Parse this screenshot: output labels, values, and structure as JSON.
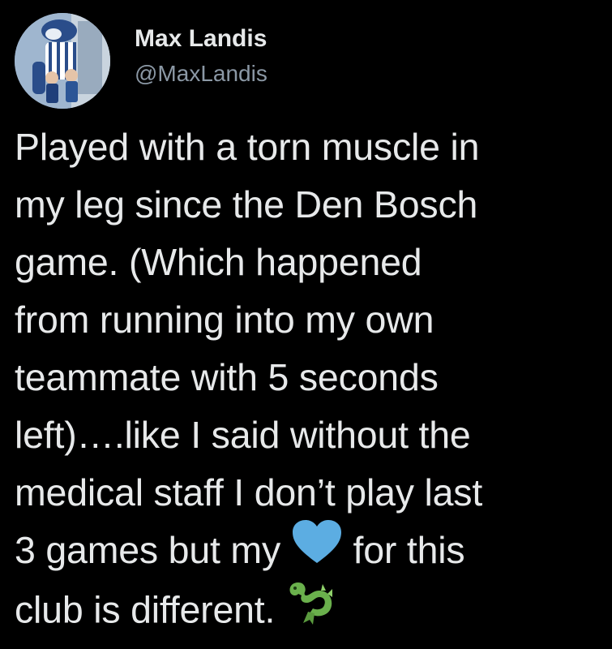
{
  "user": {
    "display_name": "Max Landis",
    "handle": "@MaxLandis"
  },
  "tweet": {
    "lines": [
      "Played with a torn muscle in",
      "my leg since the Den Bosch",
      "game. (Which happened",
      "from running into my own",
      "teammate with 5 seconds",
      "left)….like I said without the",
      "medical staff I don’t play last",
      "3 games but my",
      "for this",
      "club is different."
    ],
    "emojis": [
      "blue-heart-icon",
      "dragon-icon"
    ]
  },
  "colors": {
    "background": "#000000",
    "text": "#e7e9ea",
    "secondary_text": "#8b98a5",
    "heart": "#5cade2",
    "dragon": "#6ab04c"
  }
}
